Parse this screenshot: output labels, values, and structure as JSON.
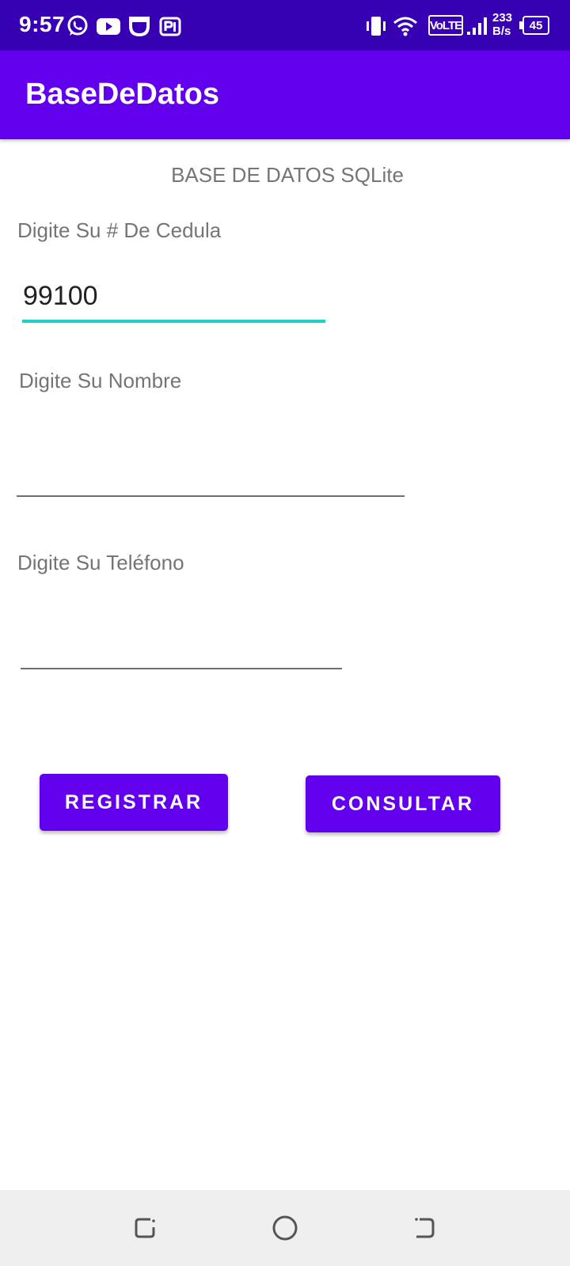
{
  "status_bar": {
    "time": "9:57",
    "notification_icons": [
      "whatsapp-icon",
      "youtube-icon",
      "cup-icon",
      "paytm-icon"
    ],
    "volte_label": "VoLTE",
    "network_speed_value": "233",
    "network_speed_unit": "B/s",
    "battery_level": "45"
  },
  "app_bar": {
    "title": "BaseDeDatos",
    "color": "#6200EE"
  },
  "form": {
    "heading": "BASE DE DATOS SQLite",
    "cedula_label": "Digite Su # De Cedula",
    "cedula_value": "99100",
    "nombre_label": "Digite Su Nombre",
    "nombre_value": "",
    "telefono_label": "Digite Su Teléfono",
    "telefono_value": ""
  },
  "buttons": {
    "registrar_label": "REGISTRAR",
    "consultar_label": "CONSULTAR"
  },
  "nav_bar": {
    "items": [
      "recent-apps-icon",
      "home-icon",
      "back-icon"
    ]
  },
  "colors": {
    "primary": "#6200EE",
    "primary_dark": "#3700B3",
    "accent": "#1FD1C4"
  }
}
